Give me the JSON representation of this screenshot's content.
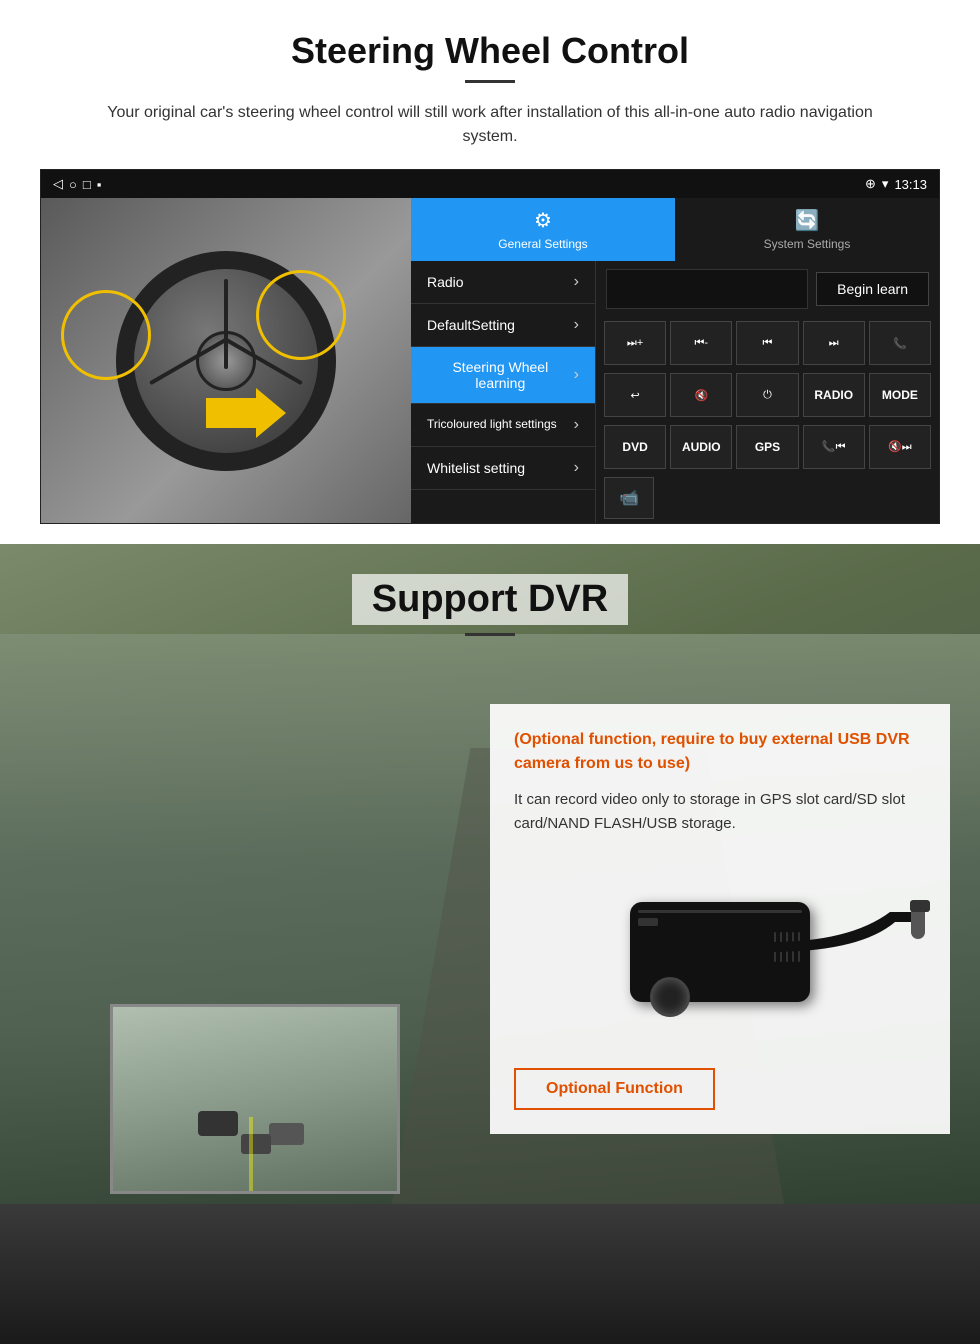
{
  "steering_section": {
    "title": "Steering Wheel Control",
    "description": "Your original car's steering wheel control will still work after installation of this all-in-one auto radio navigation system.",
    "status_bar": {
      "time": "13:13",
      "icons": [
        "wifi",
        "signal",
        "battery"
      ]
    },
    "tabs": [
      {
        "label": "General Settings",
        "active": true,
        "icon": "⚙"
      },
      {
        "label": "System Settings",
        "active": false,
        "icon": "🔄"
      }
    ],
    "menu_items": [
      {
        "label": "Radio",
        "active": false
      },
      {
        "label": "DefaultSetting",
        "active": false
      },
      {
        "label": "Steering Wheel learning",
        "active": true
      },
      {
        "label": "Tricoloured light settings",
        "active": false
      },
      {
        "label": "Whitelist setting",
        "active": false
      }
    ],
    "begin_learn_label": "Begin learn",
    "control_buttons": [
      "⏮+",
      "⏮-",
      "⏮",
      "⏭",
      "📞",
      "↩",
      "🔇",
      "⏻",
      "RADIO",
      "MODE",
      "DVD",
      "AUDIO",
      "GPS",
      "📞⏮",
      "🔇⏭"
    ],
    "dvr_icon": "📹"
  },
  "dvr_section": {
    "title": "Support DVR",
    "optional_text": "(Optional function, require to buy external USB DVR camera from us to use)",
    "description": "It can record video only to storage in GPS slot card/SD slot card/NAND FLASH/USB storage.",
    "optional_btn_label": "Optional Function"
  }
}
